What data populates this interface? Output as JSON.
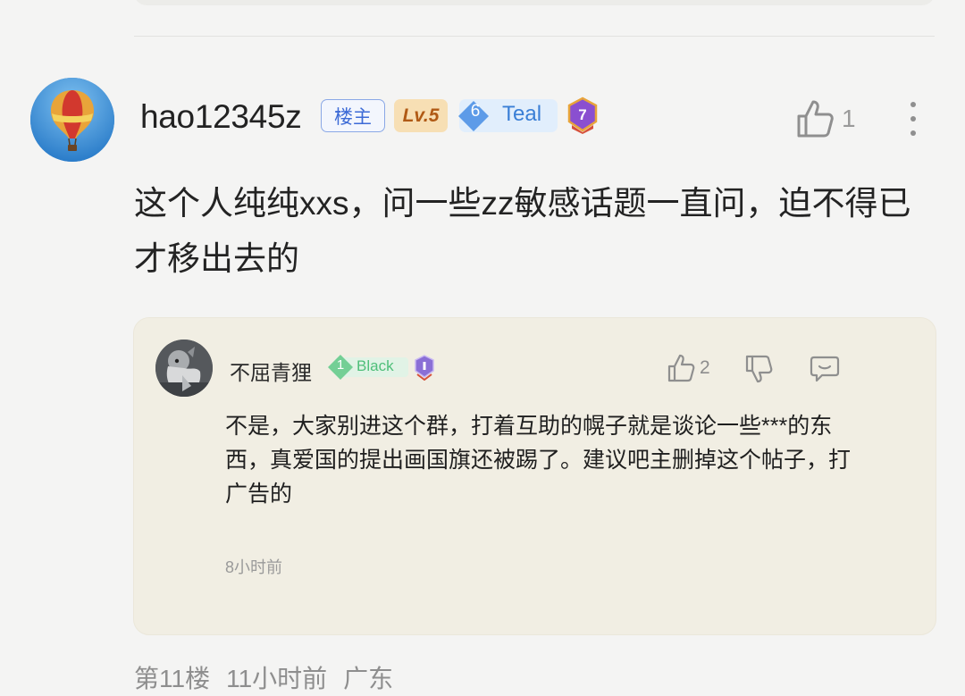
{
  "comment": {
    "username": "hao12345z",
    "op_badge": "楼主",
    "level_badge": "Lv.5",
    "fan_badge": {
      "number": "6",
      "label": "Teal",
      "color": "#3a7fd6"
    },
    "medal_number": "7",
    "like_count": "1",
    "text": "这个人纯纯xxs，问一些zz敏感话题一直问，迫不得已才移出去的",
    "floor": "第11楼",
    "time": "11小时前",
    "location": "广东"
  },
  "reply": {
    "username": "不屈青狸",
    "fan_badge": {
      "number": "1",
      "label": "Black",
      "color": "#4fbf7a"
    },
    "like_count": "2",
    "text": "不是，大家别进这个群，打着互助的幌子就是谈论一些***的东西，真爱国的提出画国旗还被踢了。建议吧主删掉这个帖子，打广告的",
    "time": "8小时前"
  },
  "icons": [
    "hot-air-balloon-avatar",
    "medal-icon",
    "thumbs-up-icon",
    "more-vertical-icon",
    "thumbs-down-icon",
    "comment-icon"
  ],
  "colors": {
    "background": "#f4f4f3",
    "reply_background": "#f1eee3",
    "op_badge": "#3c6ad6",
    "level_badge": "#b05a15"
  }
}
